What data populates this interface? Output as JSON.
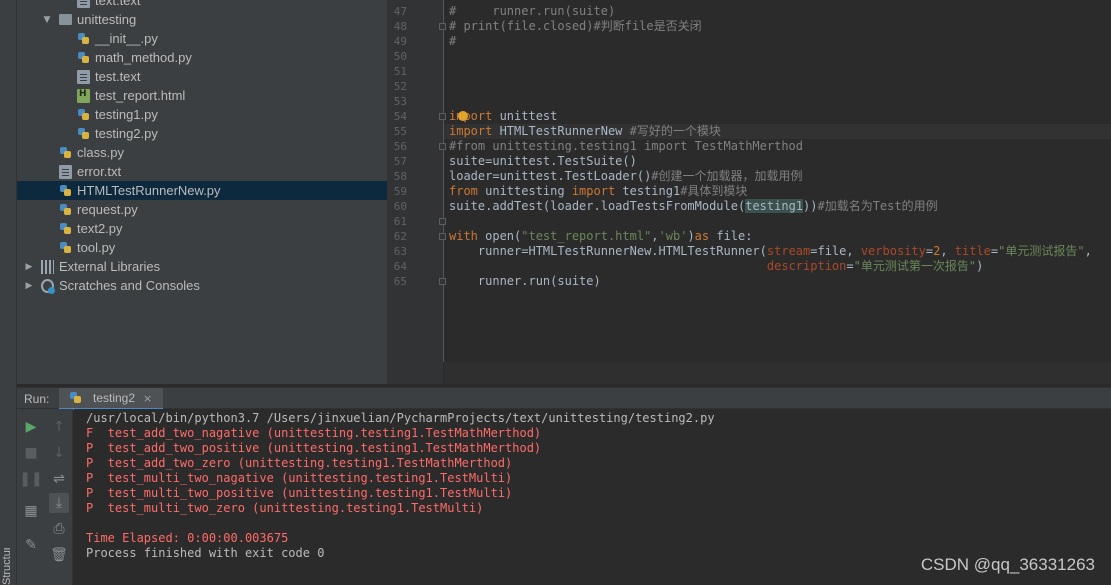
{
  "sidebar_tab": {
    "label": "Structure"
  },
  "project_tree": [
    {
      "label": "text.text",
      "indent": 3,
      "icon": "text-file-icon",
      "partial": true
    },
    {
      "label": "unittesting",
      "indent": 1,
      "icon": "folder-icon",
      "arrow": "down"
    },
    {
      "label": "__init__.py",
      "indent": 3,
      "icon": "python-file-icon"
    },
    {
      "label": "math_method.py",
      "indent": 3,
      "icon": "python-file-icon"
    },
    {
      "label": "test.text",
      "indent": 3,
      "icon": "text-file-icon"
    },
    {
      "label": "test_report.html",
      "indent": 3,
      "icon": "html-file-icon"
    },
    {
      "label": "testing1.py",
      "indent": 3,
      "icon": "python-file-icon"
    },
    {
      "label": "testing2.py",
      "indent": 3,
      "icon": "python-file-icon"
    },
    {
      "label": "class.py",
      "indent": 2,
      "icon": "python-file-icon"
    },
    {
      "label": "error.txt",
      "indent": 2,
      "icon": "text-file-icon"
    },
    {
      "label": "HTMLTestRunnerNew.py",
      "indent": 2,
      "icon": "python-file-icon",
      "selected": true
    },
    {
      "label": "request.py",
      "indent": 2,
      "icon": "python-file-icon"
    },
    {
      "label": "text2.py",
      "indent": 2,
      "icon": "python-file-icon"
    },
    {
      "label": "tool.py",
      "indent": 2,
      "icon": "python-file-icon"
    },
    {
      "label": "External Libraries",
      "indent": 0,
      "icon": "library-icon",
      "arrow": "right"
    },
    {
      "label": "Scratches and Consoles",
      "indent": 0,
      "icon": "scratches-icon",
      "arrow": "right"
    }
  ],
  "editor": {
    "line_numbers": [
      "47",
      "48",
      "49",
      "50",
      "51",
      "52",
      "53",
      "54",
      "55",
      "56",
      "57",
      "58",
      "59",
      "60",
      "61",
      "62",
      "63",
      "64",
      "65"
    ],
    "code_tokens": [
      [
        [
          "cm",
          "#     runner.run(suite)"
        ]
      ],
      [
        [
          "cm",
          "# print(file.closed)#判断file是否关闭"
        ]
      ],
      [
        [
          "cm",
          "#"
        ]
      ],
      [],
      [],
      [],
      [],
      [
        [
          "kw",
          "import "
        ],
        [
          "plain",
          "unittest"
        ]
      ],
      [
        [
          "kw",
          "import "
        ],
        [
          "plain",
          "HTMLTestRunnerNew "
        ],
        [
          "cm",
          "#写好的一个模块"
        ]
      ],
      [
        [
          "cm",
          "#from unittesting.testing1 import TestMathMerthod"
        ]
      ],
      [
        [
          "plain",
          "suite=unittest.TestSuite()"
        ]
      ],
      [
        [
          "plain",
          "loader=unittest.TestLoader()"
        ],
        [
          "cm",
          "#创建一个加载器，加载用例"
        ]
      ],
      [
        [
          "kw",
          "from "
        ],
        [
          "plain",
          "unittesting "
        ],
        [
          "kw",
          "import "
        ],
        [
          "plain",
          "testing1"
        ],
        [
          "cm",
          "#具体到模块"
        ]
      ],
      [
        [
          "plain",
          "suite.addTest(loader.loadTestsFromModule("
        ],
        [
          "hl",
          "testing1"
        ],
        [
          "plain",
          "))"
        ],
        [
          "cm",
          "#加载名为Test的用例"
        ]
      ],
      [],
      [
        [
          "kw",
          "with "
        ],
        [
          "plain",
          "open("
        ],
        [
          "str",
          "\"test_report.html\""
        ],
        [
          "plain",
          ","
        ],
        [
          "str",
          "'wb'"
        ],
        [
          "plain",
          ")"
        ],
        [
          "kw",
          "as "
        ],
        [
          "plain",
          "file:"
        ]
      ],
      [
        [
          "plain",
          "    runner=HTMLTestRunnerNew.HTMLTestRunner("
        ],
        [
          "param",
          "stream"
        ],
        [
          "plain",
          "=file, "
        ],
        [
          "param",
          "verbosity"
        ],
        [
          "plain",
          "="
        ],
        [
          "kw",
          "2"
        ],
        [
          "plain",
          ", "
        ],
        [
          "param",
          "title"
        ],
        [
          "plain",
          "="
        ],
        [
          "str",
          "\"单元测试报告\""
        ],
        [
          "plain",
          ","
        ]
      ],
      [
        [
          "plain",
          "                                            "
        ],
        [
          "param",
          "description"
        ],
        [
          "plain",
          "="
        ],
        [
          "str",
          "\"单元测试第一次报告\""
        ],
        [
          "plain",
          ")"
        ]
      ],
      [
        [
          "plain",
          "    runner.run(suite)"
        ]
      ]
    ]
  },
  "run_panel": {
    "label": "Run:",
    "tab_label": "testing2",
    "tab_close": "×"
  },
  "console_lines": [
    {
      "text": "/usr/local/bin/python3.7 /Users/jinxuelian/PycharmProjects/text/unittesting/testing2.py",
      "style": "plain"
    },
    {
      "text": "F  test_add_two_nagative (unittesting.testing1.TestMathMerthod)",
      "style": "err"
    },
    {
      "text": "P  test_add_two_positive (unittesting.testing1.TestMathMerthod)",
      "style": "err"
    },
    {
      "text": "P  test_add_two_zero (unittesting.testing1.TestMathMerthod)",
      "style": "err"
    },
    {
      "text": "P  test_multi_two_nagative (unittesting.testing1.TestMulti)",
      "style": "err"
    },
    {
      "text": "P  test_multi_two_positive (unittesting.testing1.TestMulti)",
      "style": "err"
    },
    {
      "text": "P  test_multi_two_zero (unittesting.testing1.TestMulti)",
      "style": "err"
    },
    {
      "text": "",
      "style": "plain"
    },
    {
      "text": "Time Elapsed: 0:00:00.003675",
      "style": "err"
    },
    {
      "text": "Process finished with exit code 0",
      "style": "plain"
    }
  ],
  "watermark": "CSDN @qq_36331263",
  "colors": {
    "panel_bg": "#3c3f41",
    "editor_bg": "#2b2b2b",
    "selection": "#0d293e",
    "keyword": "#cc7832",
    "string": "#6a8759",
    "comment": "#808080",
    "error_text": "#ff6b68"
  }
}
